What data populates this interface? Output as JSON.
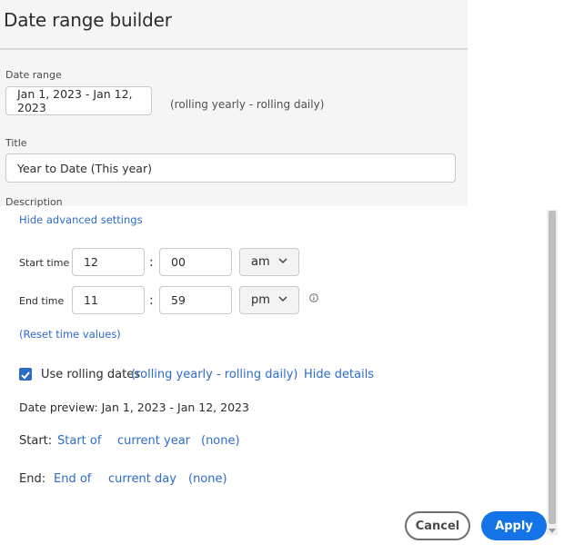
{
  "dialog": {
    "title": "Date range builder",
    "date_range_label": "Date range",
    "date_range_value": "Jan 1, 2023 - Jan 12, 2023",
    "range_description": "(rolling yearly - rolling daily)",
    "title_label": "Title",
    "title_value": "Year to Date (This year)",
    "description_label": "Description"
  },
  "advanced": {
    "hide_link": "Hide advanced settings",
    "start_time": {
      "label": "Start time",
      "hour": "12",
      "colon": ":",
      "minute": "00",
      "ampm": "am"
    },
    "end_time": {
      "label": "End time",
      "hour": "11",
      "colon": ":",
      "minute": "59",
      "ampm": "pm"
    },
    "reset_link": "(Reset time values)"
  },
  "rolling": {
    "checked": true,
    "label": "Use rolling dates",
    "mode_link": "(rolling yearly - rolling daily)",
    "hide_details": "Hide details",
    "preview": "Date preview: Jan 1, 2023 - Jan 12, 2023",
    "start": {
      "label": "Start:",
      "position": "Start of",
      "period": "current year",
      "offset": "(none)"
    },
    "end": {
      "label": "End:",
      "position": "End of",
      "period": "current day",
      "offset": "(none)"
    }
  },
  "footer": {
    "cancel": "Cancel",
    "apply": "Apply"
  },
  "colors": {
    "accent": "#1473e6",
    "link": "#2d6bc9"
  }
}
